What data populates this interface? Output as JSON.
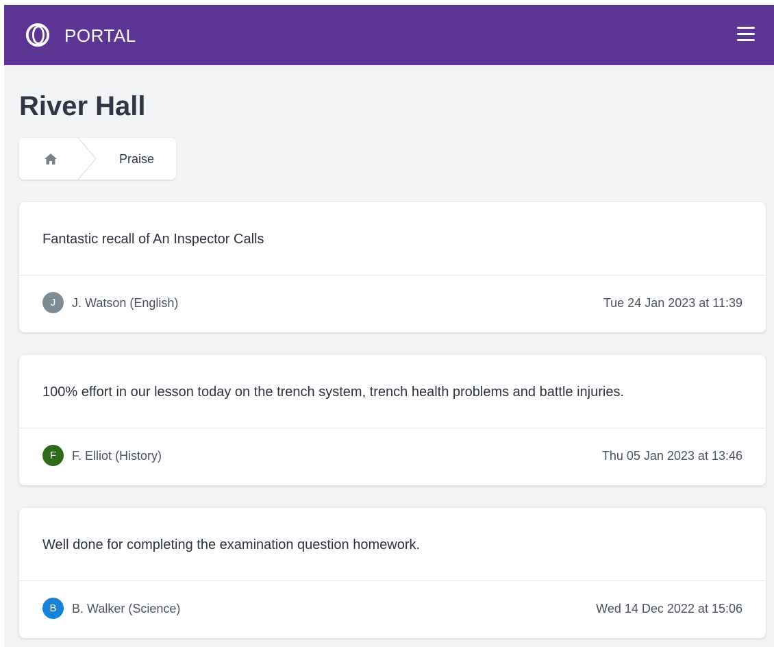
{
  "header": {
    "brand": "PORTAL",
    "logo_icon": "portal-ring-logo",
    "menu_icon": "hamburger-menu-icon",
    "background_color": "#5b3494"
  },
  "page": {
    "title": "River Hall"
  },
  "breadcrumb": {
    "home_icon": "home-icon",
    "current": "Praise"
  },
  "praise_items": [
    {
      "message": "Fantastic recall of An Inspector Calls",
      "avatar_initial": "J",
      "avatar_color": "#7d8b95",
      "author": "J. Watson (English)",
      "timestamp": "Tue 24 Jan 2023 at 11:39"
    },
    {
      "message": "100% effort in our lesson today on the trench system, trench health problems and battle injuries.",
      "avatar_initial": "F",
      "avatar_color": "#2f6a1d",
      "author": "F. Elliot (History)",
      "timestamp": "Thu 05 Jan 2023 at 13:46"
    },
    {
      "message": "Well done for completing the examination question homework.",
      "avatar_initial": "B",
      "avatar_color": "#1683d8",
      "author": "B. Walker (Science)",
      "timestamp": "Wed 14 Dec 2022 at 15:06"
    }
  ]
}
